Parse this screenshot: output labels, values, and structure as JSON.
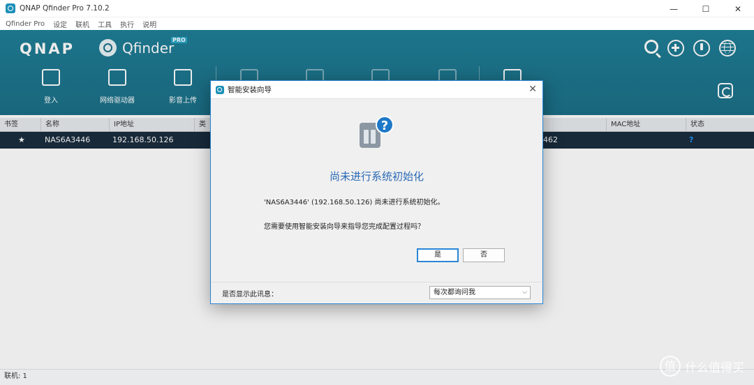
{
  "window": {
    "title": "QNAP Qfinder Pro 7.10.2",
    "controls": [
      "—",
      "☐",
      "✕"
    ]
  },
  "menu": [
    "Qfinder Pro",
    "设定",
    "联机",
    "工具",
    "执行",
    "说明"
  ],
  "header": {
    "brand": "QNAP",
    "product": "Qfinder",
    "pro_badge": "PRO",
    "right_icons": [
      "search-icon",
      "add-icon",
      "plug-icon",
      "globe-icon"
    ]
  },
  "toolbar": [
    {
      "label": "登入",
      "icon": "login-icon",
      "enabled": true
    },
    {
      "label": "网络驱动器",
      "icon": "folder-icon",
      "enabled": true
    },
    {
      "label": "影音上传",
      "icon": "upload-icon",
      "enabled": true
    },
    {
      "label": "",
      "icon": "gear-icon",
      "enabled": false
    },
    {
      "label": "",
      "icon": "details-icon",
      "enabled": false
    },
    {
      "label": "",
      "icon": "monitor-icon",
      "enabled": false
    },
    {
      "label": "",
      "icon": "location-icon",
      "enabled": false
    },
    {
      "label": "",
      "icon": "star-icon",
      "enabled": true
    }
  ],
  "table": {
    "columns": [
      "书签",
      "名称",
      "IP地址",
      "类",
      "MAC地址",
      "状态"
    ],
    "rows": [
      {
        "bookmark": "★",
        "name": "NAS6A3446",
        "ip": "192.168.50.126",
        "mac_tail": "462",
        "status": "?"
      }
    ]
  },
  "statusbar": {
    "text": "联机: 1"
  },
  "dialog": {
    "title": "智能安装向导",
    "heading": "尚未进行系统初始化",
    "message1": "'NAS6A3446' (192.168.50.126) 尚未进行系统初始化。",
    "message2": "您需要使用智能安装向导来指导您完成配置过程吗？",
    "yes": "是",
    "no": "否",
    "footer_label": "是否显示此讯息：",
    "footer_select": "每次都询问我"
  },
  "watermark": {
    "badge": "值",
    "text": "什么值得买"
  }
}
